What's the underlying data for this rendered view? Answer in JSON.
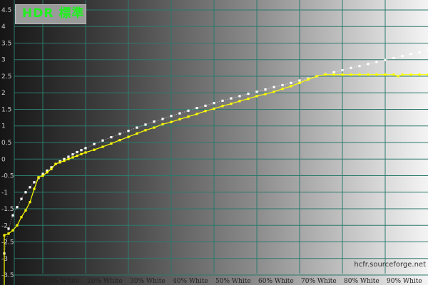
{
  "chart_data": {
    "type": "line",
    "title": "HDR 標準",
    "watermark": "hcfr.sourceforge.net",
    "ylim": [
      -3.8,
      4.8
    ],
    "xlim": [
      0,
      100
    ],
    "y_ticks": [
      4.5,
      4,
      3.5,
      3,
      2.5,
      2,
      1.5,
      1,
      0.5,
      0,
      -0.5,
      -1,
      -1.5,
      -2,
      -2.5,
      -3,
      -3.5
    ],
    "y_tick_labels": [
      "4.5",
      "4",
      "3.5",
      "3",
      "2.5",
      "2",
      "1.5",
      "1",
      "0.5",
      "0",
      "-0.5",
      "-1",
      "-1.5",
      "-2",
      "-2.5",
      "-3",
      "-3.5"
    ],
    "x_ticks": [
      10,
      20,
      30,
      40,
      50,
      60,
      70,
      80,
      90
    ],
    "x_tick_labels": [
      "10% White",
      "20% White",
      "30% White",
      "40% White",
      "50% White",
      "60% White",
      "70% White",
      "80% White",
      "90% White"
    ],
    "grid": true,
    "colors": {
      "reference": "#ffffff",
      "measured": "#ffff00",
      "grid": "#2c7a6c",
      "title": "#22ee22"
    },
    "series": [
      {
        "key": "reference",
        "x": [
          1,
          2,
          3,
          4,
          5,
          6,
          7,
          8,
          9,
          10,
          11,
          12,
          13,
          14,
          15,
          16,
          17,
          18,
          19,
          20,
          22,
          24,
          26,
          28,
          30,
          32,
          34,
          36,
          38,
          40,
          42,
          44,
          46,
          48,
          50,
          52,
          54,
          56,
          58,
          60,
          62,
          64,
          66,
          68,
          70,
          72,
          74,
          76,
          78,
          80,
          82,
          84,
          86,
          88,
          90,
          92,
          94,
          96,
          98,
          100
        ],
        "values": [
          -2.85,
          -2.1,
          -1.7,
          -1.45,
          -1.2,
          -1.0,
          -0.85,
          -0.7,
          -0.57,
          -0.45,
          -0.35,
          -0.25,
          -0.15,
          -0.07,
          0.0,
          0.07,
          0.14,
          0.21,
          0.27,
          0.33,
          0.45,
          0.56,
          0.66,
          0.76,
          0.85,
          0.95,
          1.04,
          1.13,
          1.21,
          1.3,
          1.38,
          1.46,
          1.54,
          1.61,
          1.69,
          1.76,
          1.83,
          1.9,
          1.97,
          2.03,
          2.1,
          2.17,
          2.23,
          2.3,
          2.37,
          2.43,
          2.5,
          2.56,
          2.62,
          2.68,
          2.75,
          2.81,
          2.87,
          2.93,
          2.99,
          3.05,
          3.11,
          3.17,
          3.22,
          3.28
        ]
      },
      {
        "key": "measured",
        "x": [
          1,
          2,
          3,
          4,
          5,
          6,
          7,
          8,
          9,
          10,
          11,
          12,
          13,
          14,
          15,
          16,
          17,
          18,
          19,
          20,
          22,
          24,
          26,
          28,
          30,
          32,
          34,
          36,
          38,
          40,
          42,
          44,
          46,
          48,
          50,
          52,
          54,
          56,
          58,
          60,
          62,
          64,
          66,
          68,
          70,
          72,
          74,
          76,
          78,
          80,
          82,
          84,
          86,
          88,
          90,
          92,
          93,
          94,
          96,
          98,
          100
        ],
        "values": [
          -2.3,
          -2.25,
          -2.15,
          -2.0,
          -1.75,
          -1.55,
          -1.3,
          -0.9,
          -0.55,
          -0.5,
          -0.4,
          -0.3,
          -0.15,
          -0.1,
          -0.05,
          0.0,
          0.05,
          0.1,
          0.15,
          0.2,
          0.28,
          0.37,
          0.47,
          0.57,
          0.67,
          0.77,
          0.87,
          0.95,
          1.05,
          1.12,
          1.2,
          1.28,
          1.36,
          1.45,
          1.52,
          1.6,
          1.67,
          1.75,
          1.82,
          1.9,
          1.96,
          2.03,
          2.12,
          2.2,
          2.3,
          2.4,
          2.5,
          2.55,
          2.55,
          2.55,
          2.55,
          2.55,
          2.55,
          2.55,
          2.55,
          2.55,
          2.5,
          2.55,
          2.55,
          2.55,
          2.55
        ]
      }
    ]
  }
}
